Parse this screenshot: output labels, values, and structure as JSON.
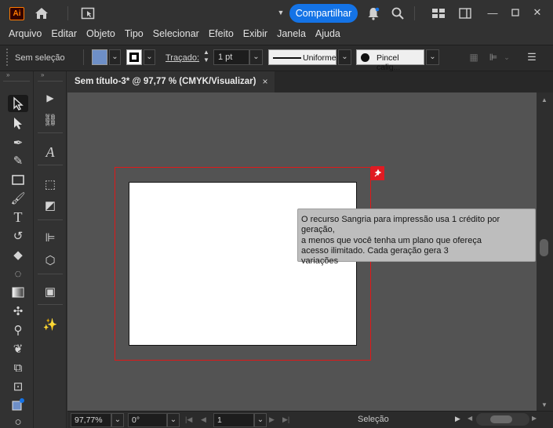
{
  "titlebar": {
    "app_badge": "Ai",
    "share_label": "Compartilhar"
  },
  "menu": [
    "Arquivo",
    "Editar",
    "Objeto",
    "Tipo",
    "Selecionar",
    "Efeito",
    "Exibir",
    "Janela",
    "Ajuda"
  ],
  "controlbar": {
    "selection_label": "Sem seleção",
    "fill_color": "#6e8fc7",
    "stroke_label": "Traçado:",
    "stroke_weight": "1 pt",
    "stroke_profile": "Uniforme",
    "brush_name": "Pincel calig..."
  },
  "document": {
    "tab_title": "Sem título-3* @ 97,77 % (CMYK/Visualizar)",
    "tab_close": "×"
  },
  "tooltip": {
    "text": "O recurso Sangria para impressão usa 1 crédito por geração,\na menos que você tenha um plano que ofereça\nacesso ilimitado. Cada geração gera 3\nvariações"
  },
  "statusbar": {
    "zoom": "97,77%",
    "rotation": "0°",
    "artboard_number": "1",
    "tool_status": "Seleção"
  },
  "colors": {
    "accent": "#1473e6",
    "bleed_guide": "#e01818",
    "canvas": "#535353"
  }
}
